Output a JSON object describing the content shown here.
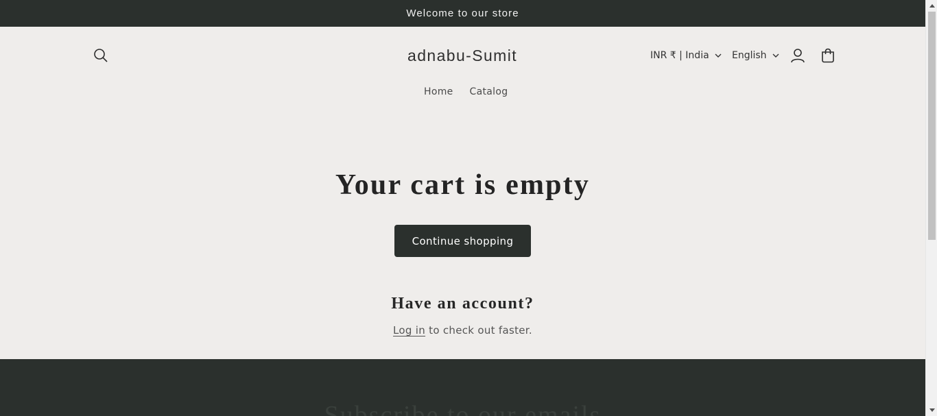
{
  "announcement": {
    "text": "Welcome to our store"
  },
  "header": {
    "logo": "adnabu-Sumit",
    "currency": "INR ₹ | India",
    "language": "English",
    "icons": {
      "search": "search-icon",
      "account": "account-icon",
      "cart": "cart-icon",
      "chevron": "chevron-down-icon"
    }
  },
  "nav": {
    "items": [
      {
        "label": "Home"
      },
      {
        "label": "Catalog"
      }
    ]
  },
  "cart": {
    "title": "Your cart is empty",
    "continue_label": "Continue shopping",
    "account_heading": "Have an account?",
    "login_link": "Log in",
    "login_suffix": " to check out faster."
  },
  "footer": {
    "heading": "Subscribe to our emails"
  },
  "colors": {
    "background": "#efedeb",
    "dark": "#2b302d",
    "text": "#242424"
  }
}
